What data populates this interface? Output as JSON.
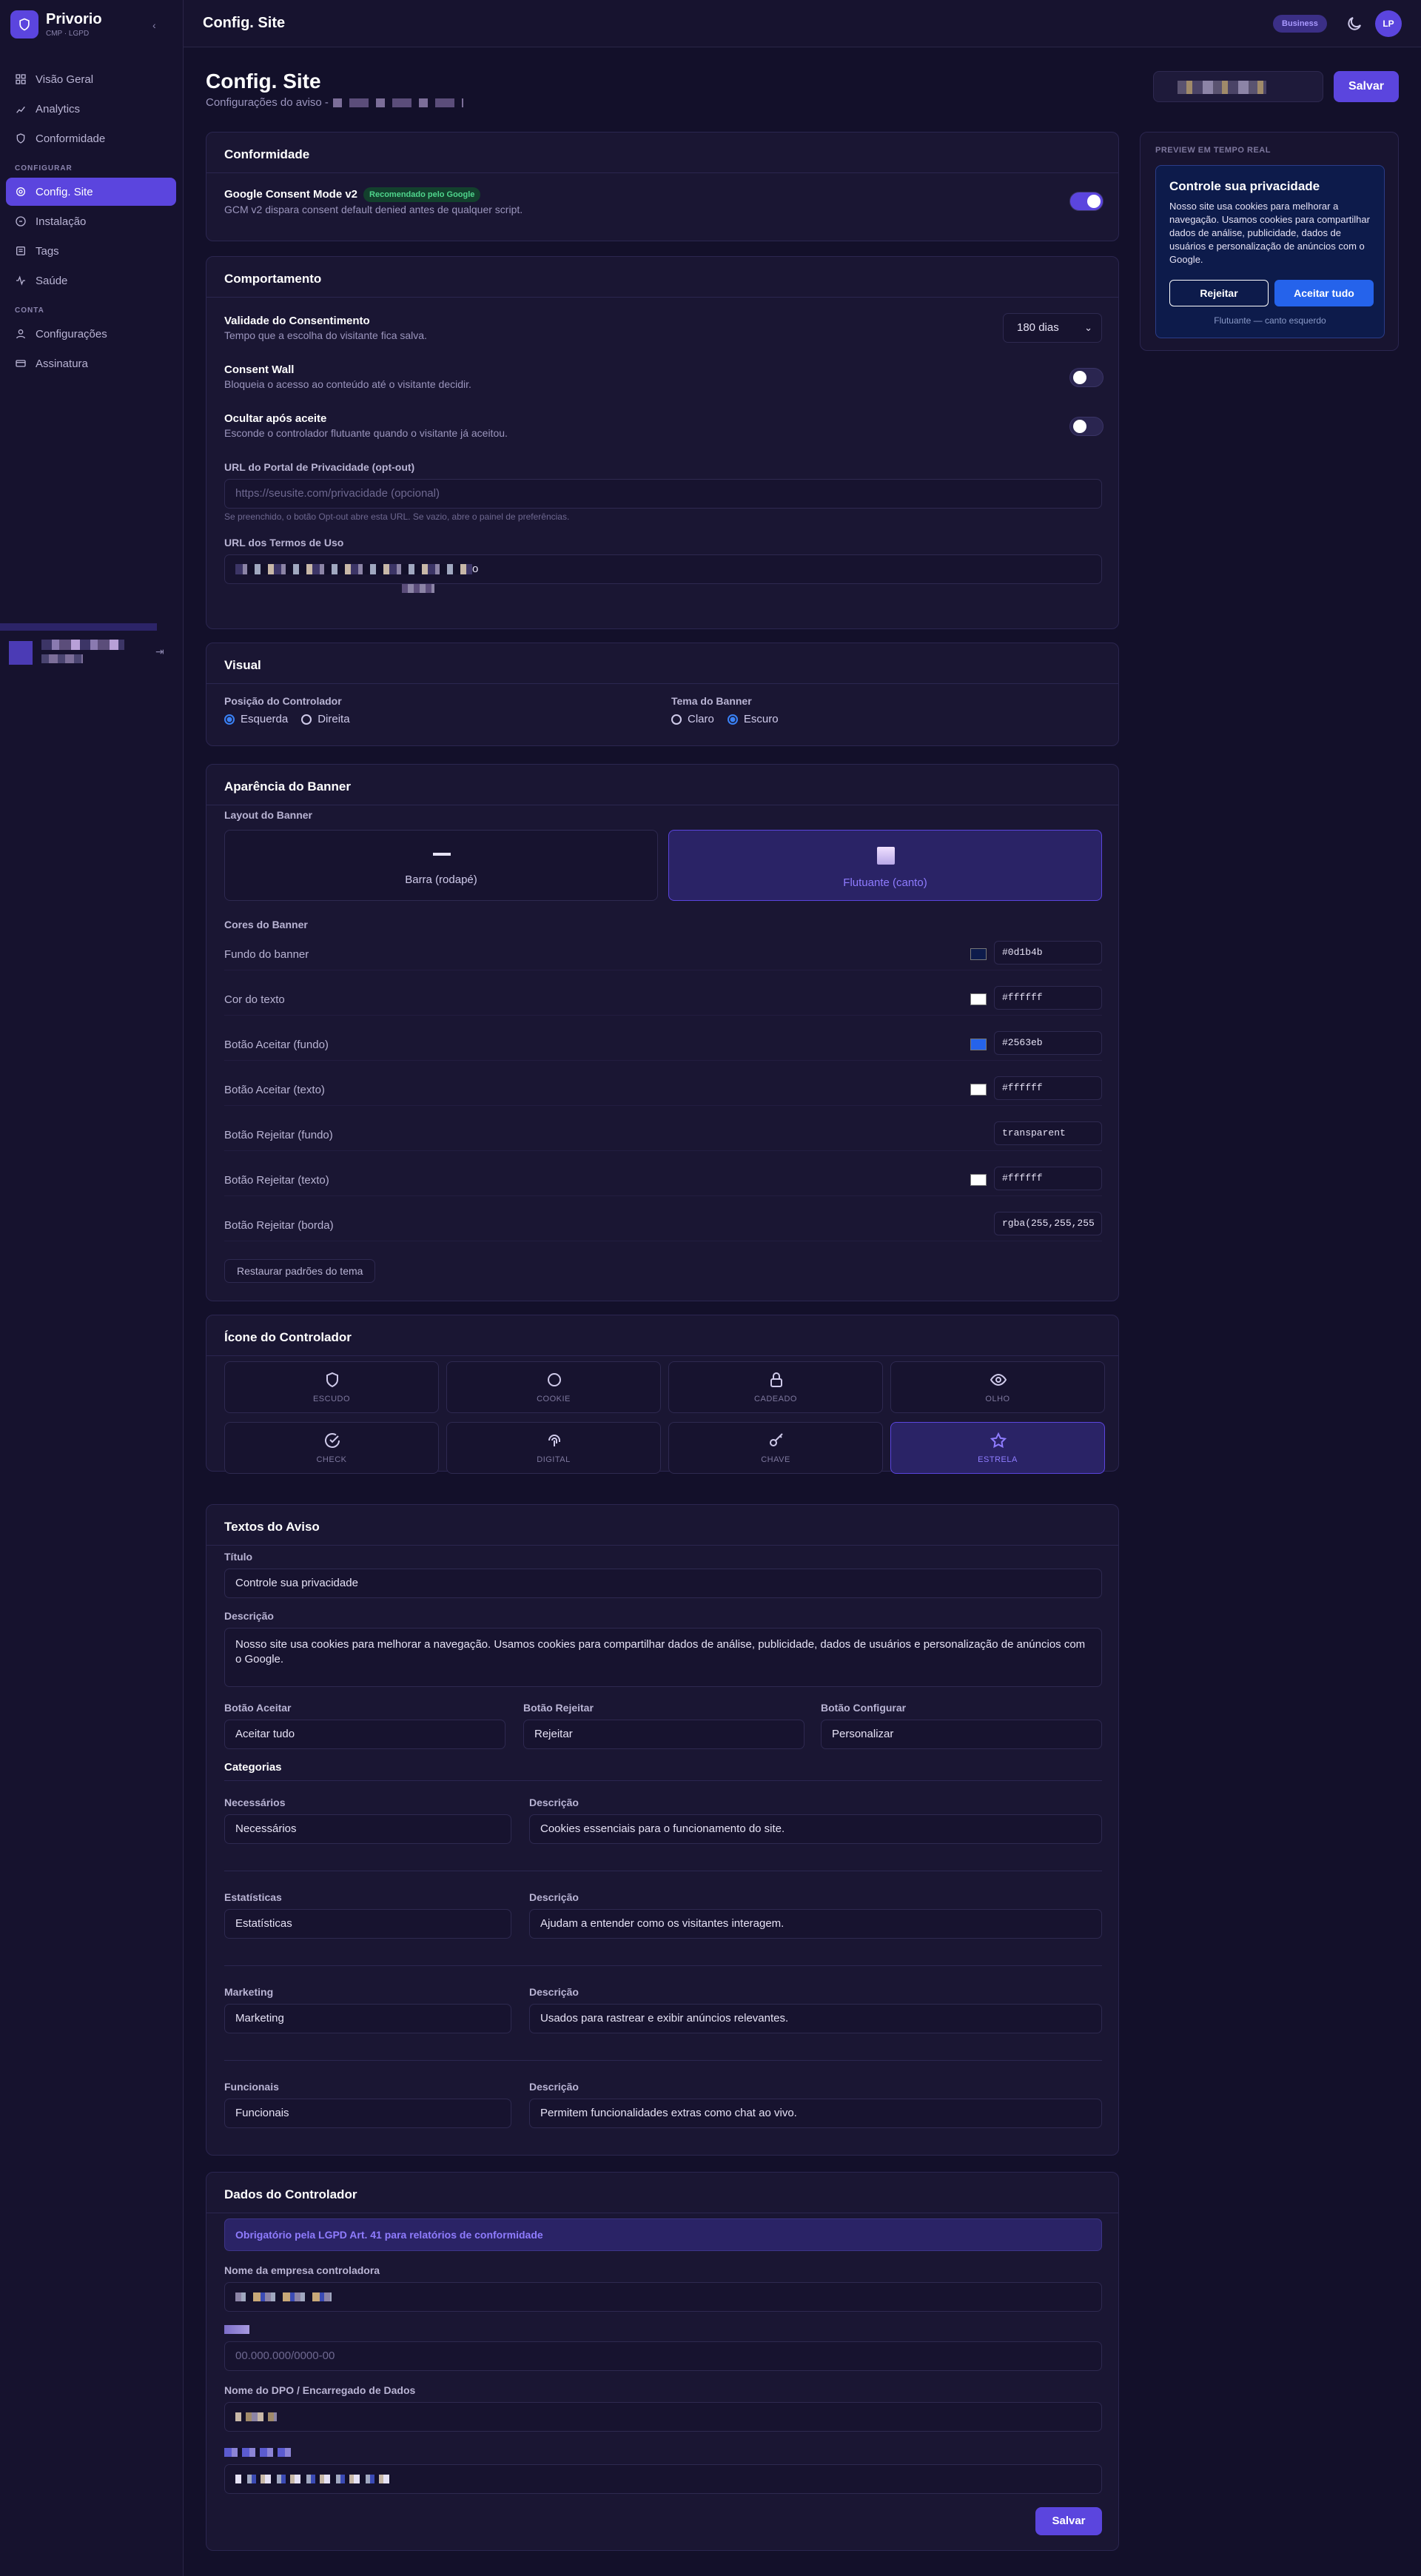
{
  "brand": {
    "name": "Privorio",
    "sub": "CMP · LGPD"
  },
  "sidebar": {
    "items": [
      {
        "label": "Visão Geral",
        "icon": "grid-icon"
      },
      {
        "label": "Analytics",
        "icon": "chart-icon"
      },
      {
        "label": "Conformidade",
        "icon": "shield-icon"
      }
    ],
    "section_configurar": "CONFIGURAR",
    "config_items": [
      {
        "label": "Config. Site",
        "icon": "gear-icon",
        "active": true
      },
      {
        "label": "Instalação",
        "icon": "code-icon"
      },
      {
        "label": "Tags",
        "icon": "tag-icon"
      },
      {
        "label": "Saúde",
        "icon": "pulse-icon"
      }
    ],
    "section_conta": "CONTA",
    "conta_items": [
      {
        "label": "Configurações",
        "icon": "user-icon"
      },
      {
        "label": "Assinatura",
        "icon": "card-icon"
      }
    ]
  },
  "topbar": {
    "title": "Config. Site",
    "plan_badge": "Business",
    "avatar": "LP"
  },
  "page": {
    "title": "Config. Site",
    "subtitle": "Configurações do aviso -",
    "save_label": "Salvar"
  },
  "conformidade": {
    "title": "Conformidade",
    "gcm_label": "Google Consent Mode v2",
    "gcm_badge": "Recomendado pelo Google",
    "gcm_help": "GCM v2 dispara consent default denied antes de qualquer script.",
    "gcm_on": true
  },
  "comportamento": {
    "title": "Comportamento",
    "validade_label": "Validade do Consentimento",
    "validade_help": "Tempo que a escolha do visitante fica salva.",
    "validade_value": "180 dias",
    "wall_label": "Consent Wall",
    "wall_help": "Bloqueia o acesso ao conteúdo até o visitante decidir.",
    "ocultar_label": "Ocultar após aceite",
    "ocultar_help": "Esconde o controlador flutuante quando o visitante já aceitou.",
    "portal_label": "URL do Portal de Privacidade (opt-out)",
    "portal_placeholder": "https://seusite.com/privacidade (opcional)",
    "portal_help": "Se preenchido, o botão Opt-out abre esta URL. Se vazio, abre o painel de preferências.",
    "termos_label": "URL dos Termos de Uso",
    "termos_tail": "o"
  },
  "visual": {
    "title": "Visual",
    "posicao_label": "Posição do Controlador",
    "posicao_options": [
      "Esquerda",
      "Direita"
    ],
    "posicao_selected": "Esquerda",
    "tema_label": "Tema do Banner",
    "tema_options": [
      "Claro",
      "Escuro"
    ],
    "tema_selected": "Escuro"
  },
  "aparencia": {
    "title": "Aparência do Banner",
    "layout_label": "Layout do Banner",
    "layouts": [
      "Barra (rodapé)",
      "Flutuante (canto)"
    ],
    "layout_selected": "Flutuante (canto)",
    "cores_label": "Cores do Banner",
    "colors": [
      {
        "name": "Fundo do banner",
        "value": "#0d1b4b",
        "swatch": "#0d1b4b"
      },
      {
        "name": "Cor do texto",
        "value": "#ffffff",
        "swatch": "#ffffff"
      },
      {
        "name": "Botão Aceitar (fundo)",
        "value": "#2563eb",
        "swatch": "#2563eb"
      },
      {
        "name": "Botão Aceitar (texto)",
        "value": "#ffffff",
        "swatch": "#ffffff"
      },
      {
        "name": "Botão Rejeitar (fundo)",
        "value": "transparent",
        "swatch": ""
      },
      {
        "name": "Botão Rejeitar (texto)",
        "value": "#ffffff",
        "swatch": "#ffffff"
      },
      {
        "name": "Botão Rejeitar (borda)",
        "value": "rgba(255,255,255",
        "swatch": ""
      }
    ],
    "restore_label": "Restaurar padrões do tema"
  },
  "icone": {
    "title": "Ícone do Controlador",
    "options": [
      {
        "label": "ESCUDO",
        "icon": "shield-icon"
      },
      {
        "label": "COOKIE",
        "icon": "circle-icon"
      },
      {
        "label": "CADEADO",
        "icon": "lock-icon"
      },
      {
        "label": "OLHO",
        "icon": "eye-icon"
      },
      {
        "label": "CHECK",
        "icon": "check-circle-icon"
      },
      {
        "label": "DIGITAL",
        "icon": "fingerprint-icon"
      },
      {
        "label": "CHAVE",
        "icon": "key-icon"
      },
      {
        "label": "ESTRELA",
        "icon": "star-icon"
      }
    ],
    "selected": "ESTRELA"
  },
  "textos": {
    "title": "Textos do Aviso",
    "titulo_label": "Título",
    "titulo_value": "Controle sua privacidade",
    "descricao_label": "Descrição",
    "descricao_value": "Nosso site usa cookies para melhorar a navegação. Usamos cookies para compartilhar dados de análise, publicidade, dados de usuários e personalização de anúncios com o Google.",
    "aceitar_label": "Botão Aceitar",
    "aceitar_value": "Aceitar tudo",
    "rejeitar_label": "Botão Rejeitar",
    "rejeitar_value": "Rejeitar",
    "configurar_label": "Botão Configurar",
    "configurar_value": "Personalizar",
    "categorias_title": "Categorias",
    "desc_label": "Descrição",
    "categorias": [
      {
        "name": "Necessários",
        "desc": "Cookies essenciais para o funcionamento do site."
      },
      {
        "name": "Estatísticas",
        "desc": "Ajudam a entender como os visitantes interagem."
      },
      {
        "name": "Marketing",
        "desc": "Usados para rastrear e exibir anúncios relevantes."
      },
      {
        "name": "Funcionais",
        "desc": "Permitem funcionalidades extras como chat ao vivo."
      }
    ]
  },
  "controlador": {
    "title": "Dados do Controlador",
    "info": "Obrigatório pela LGPD Art. 41 para relatórios de conformidade",
    "empresa_label": "Nome da empresa controladora",
    "cnpj_placeholder": "00.000.000/0000-00",
    "dpo_label": "Nome do DPO / Encarregado de Dados",
    "save_label": "Salvar"
  },
  "preview": {
    "label": "PREVIEW EM TEMPO REAL",
    "title": "Controle sua privacidade",
    "desc": "Nosso site usa cookies para melhorar a navegação. Usamos cookies para compartilhar dados de análise, publicidade, dados de usuários e personalização de anúncios com o Google.",
    "reject": "Rejeitar",
    "accept": "Aceitar tudo",
    "footer": "Flutuante — canto esquerdo"
  },
  "colors": {
    "accent": "#5b45de",
    "page_bg": "#13102a",
    "card_bg": "#1a1633",
    "preview_bg": "#0d1b4b",
    "accept_btn": "#2563eb"
  }
}
